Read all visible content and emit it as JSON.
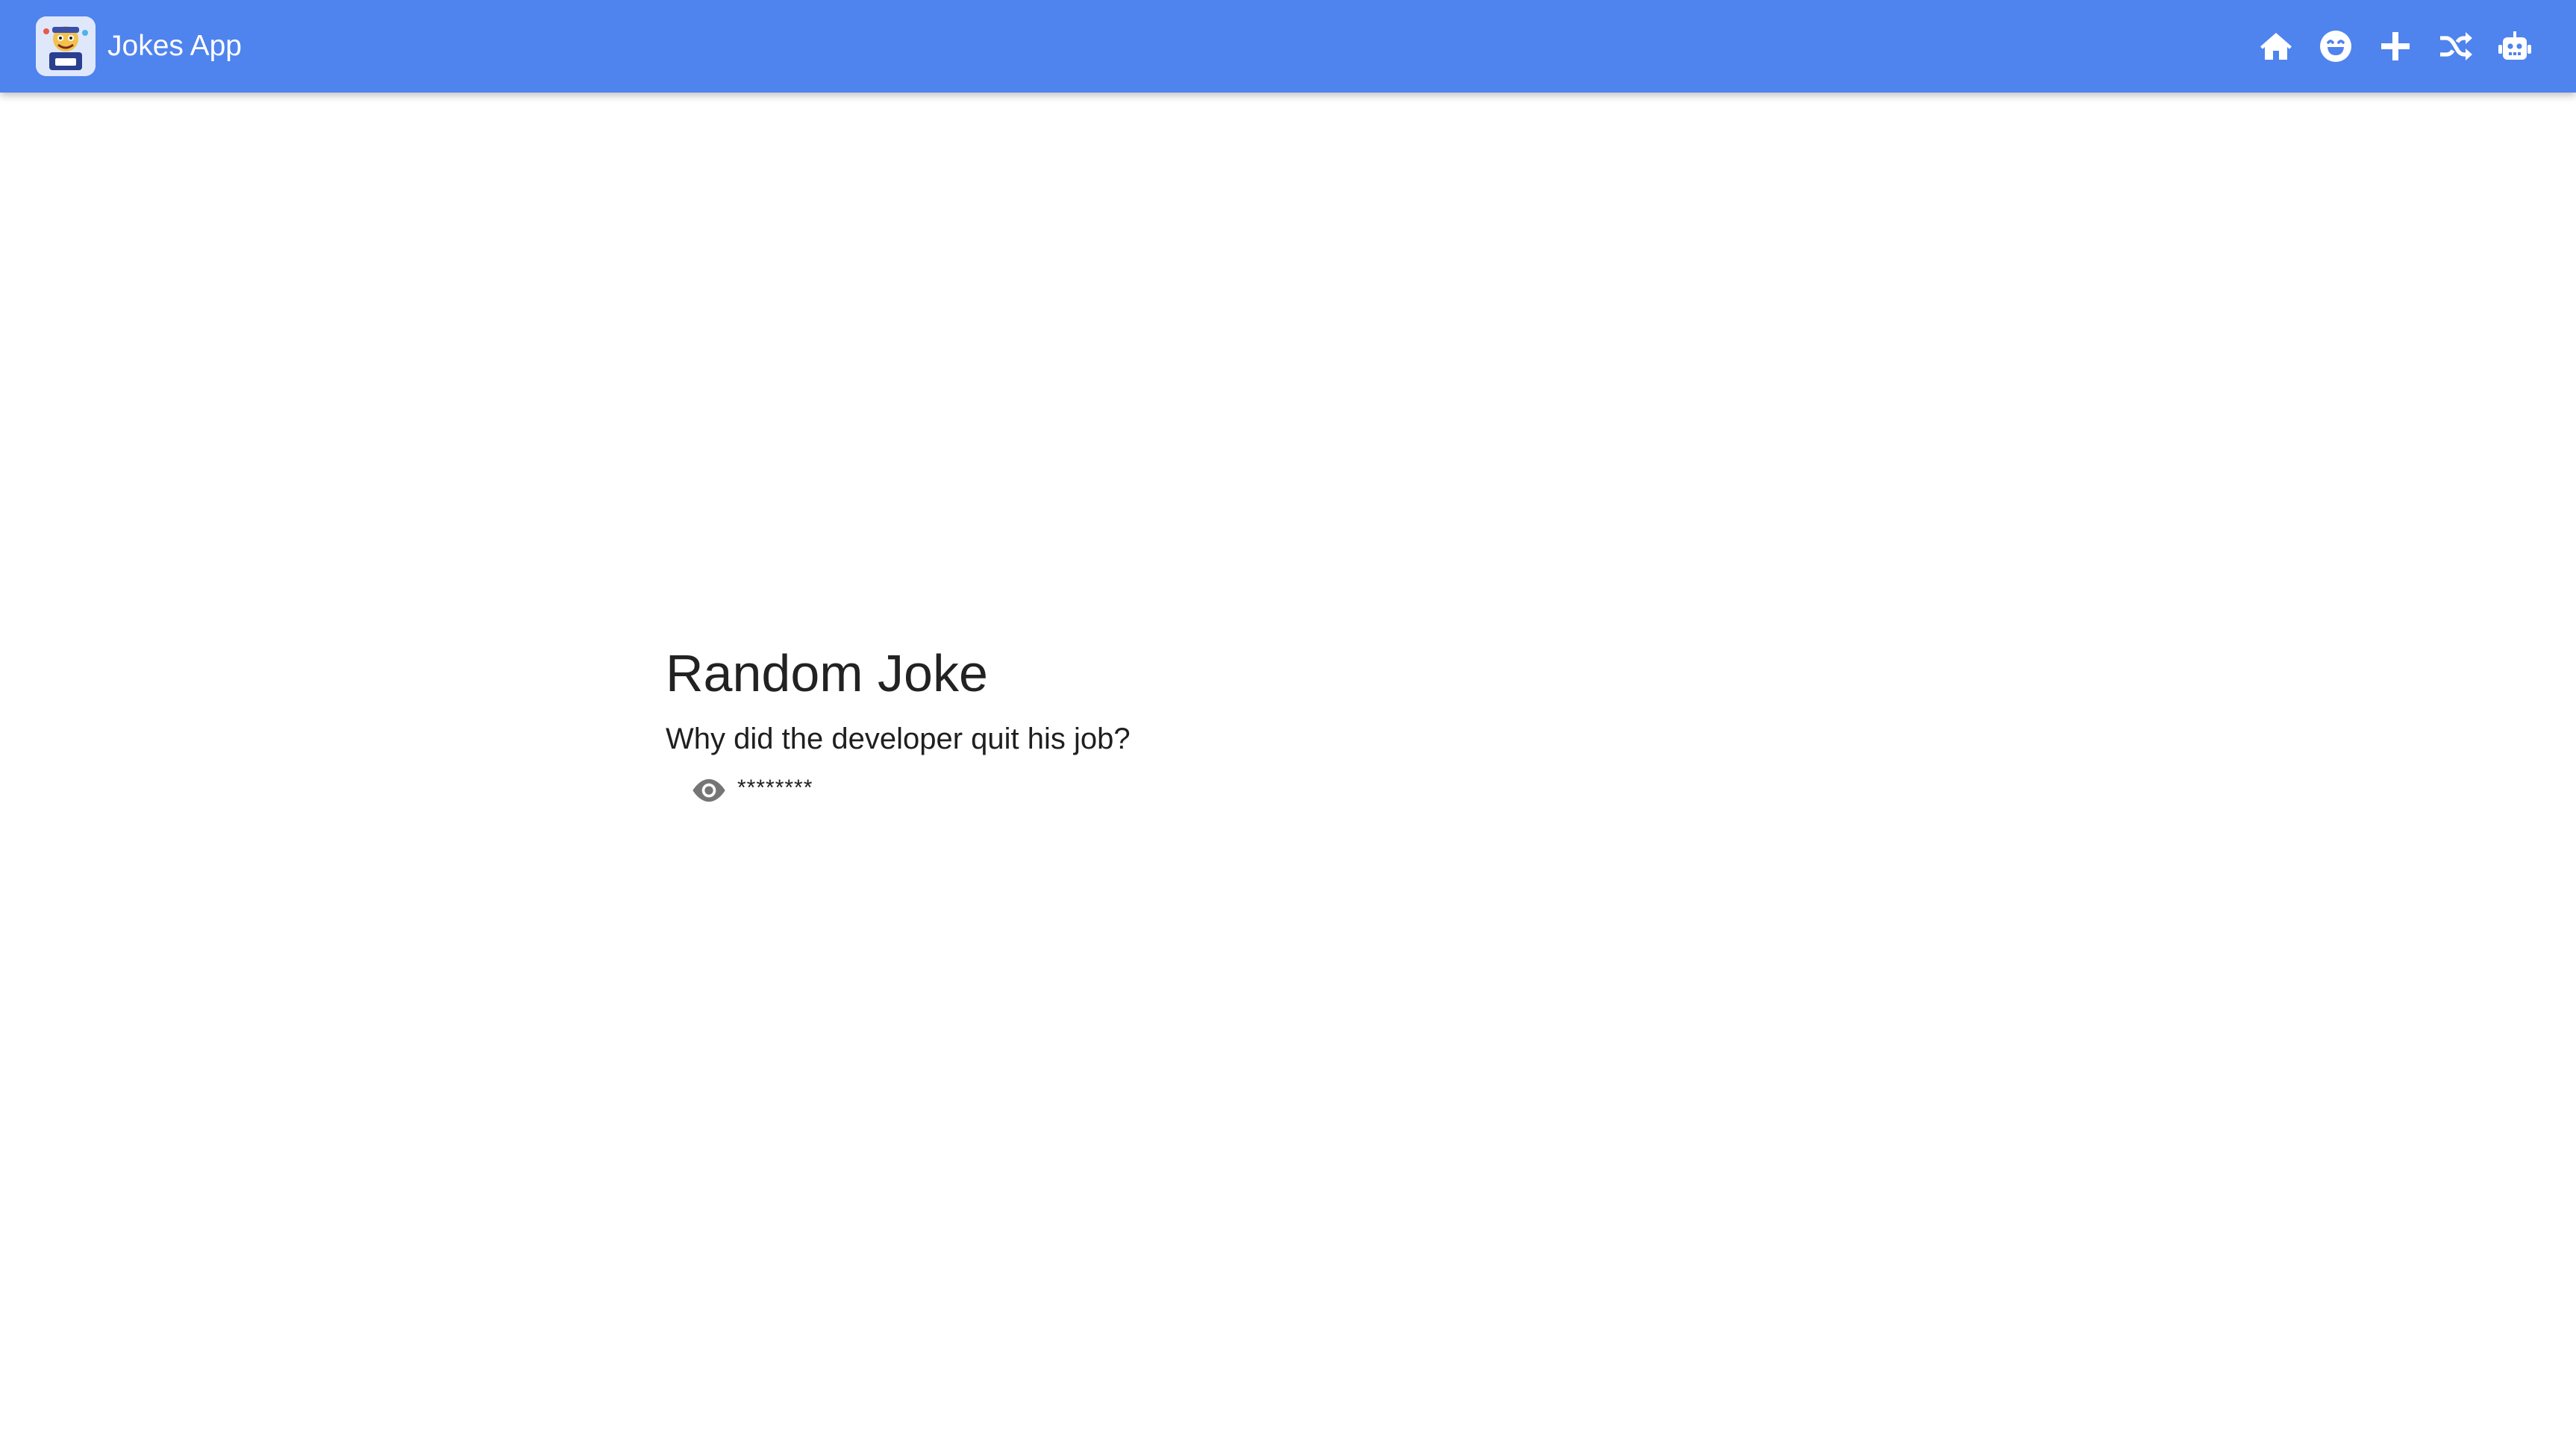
{
  "appbar": {
    "title": "Jokes App",
    "background_color": "#4f83ee",
    "logo_icon": "jokes-logo-icon",
    "nav": [
      {
        "name": "home",
        "icon": "home-icon"
      },
      {
        "name": "jokes",
        "icon": "smile-icon"
      },
      {
        "name": "add",
        "icon": "plus-icon"
      },
      {
        "name": "random",
        "icon": "shuffle-icon"
      },
      {
        "name": "ai",
        "icon": "robot-icon"
      }
    ]
  },
  "main": {
    "title": "Random Joke",
    "setup": "Why did the developer quit his job?",
    "punchline_masked": "********",
    "reveal_icon": "eye-icon"
  }
}
